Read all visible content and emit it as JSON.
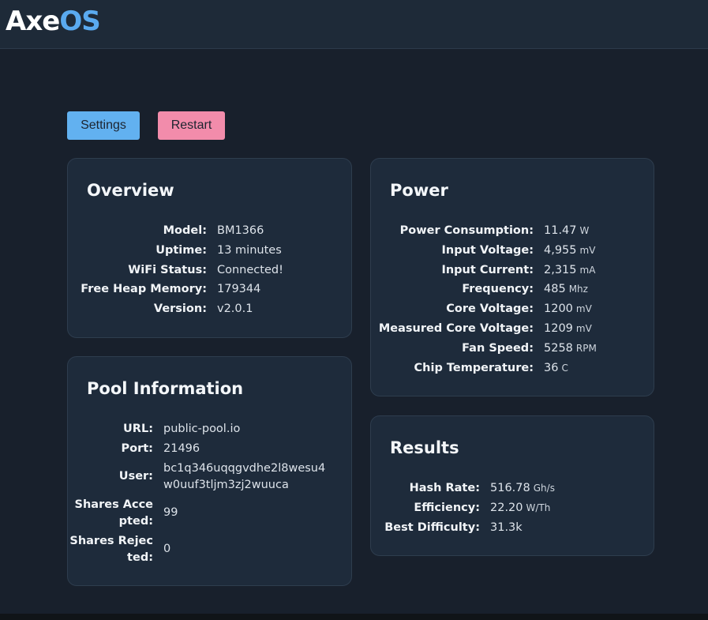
{
  "app": {
    "logo_part1": "Axe",
    "logo_part2": "OS"
  },
  "actions": {
    "settings_label": "Settings",
    "restart_label": "Restart"
  },
  "overview": {
    "title": "Overview",
    "rows": [
      {
        "label": "Model:",
        "value": "BM1366"
      },
      {
        "label": "Uptime:",
        "value": "13 minutes"
      },
      {
        "label": "WiFi Status:",
        "value": "Connected!"
      },
      {
        "label": "Free Heap Memory:",
        "value": "179344"
      },
      {
        "label": "Version:",
        "value": "v2.0.1"
      }
    ]
  },
  "pool": {
    "title": "Pool Information",
    "rows": [
      {
        "label": "URL:",
        "value": "public-pool.io"
      },
      {
        "label": "Port:",
        "value": "21496"
      },
      {
        "label": "User:",
        "value": "bc1q346uqqgvdhe2l8wesu4w0uuf3tljm3zj2wuuca"
      },
      {
        "label": "Shares Accepted:",
        "value": "99"
      },
      {
        "label": "Shares Rejected:",
        "value": "0"
      }
    ]
  },
  "power": {
    "title": "Power",
    "rows": [
      {
        "label": "Power Consumption:",
        "value": "11.47",
        "unit": "W"
      },
      {
        "label": "Input Voltage:",
        "value": "4,955",
        "unit": "mV"
      },
      {
        "label": "Input Current:",
        "value": "2,315",
        "unit": "mA"
      },
      {
        "label": "Frequency:",
        "value": "485",
        "unit": "Mhz"
      },
      {
        "label": "Core Voltage:",
        "value": "1200",
        "unit": "mV"
      },
      {
        "label": "Measured Core Voltage:",
        "value": "1209",
        "unit": "mV"
      },
      {
        "label": "Fan Speed:",
        "value": "5258",
        "unit": "RPM"
      },
      {
        "label": "Chip Temperature:",
        "value": "36",
        "unit": "C"
      }
    ]
  },
  "results": {
    "title": "Results",
    "rows": [
      {
        "label": "Hash Rate:",
        "value": "516.78",
        "unit": "Gh/s"
      },
      {
        "label": "Efficiency:",
        "value": "22.20",
        "unit": "W/Th"
      },
      {
        "label": "Best Difficulty:",
        "value": "31.3k"
      }
    ]
  }
}
